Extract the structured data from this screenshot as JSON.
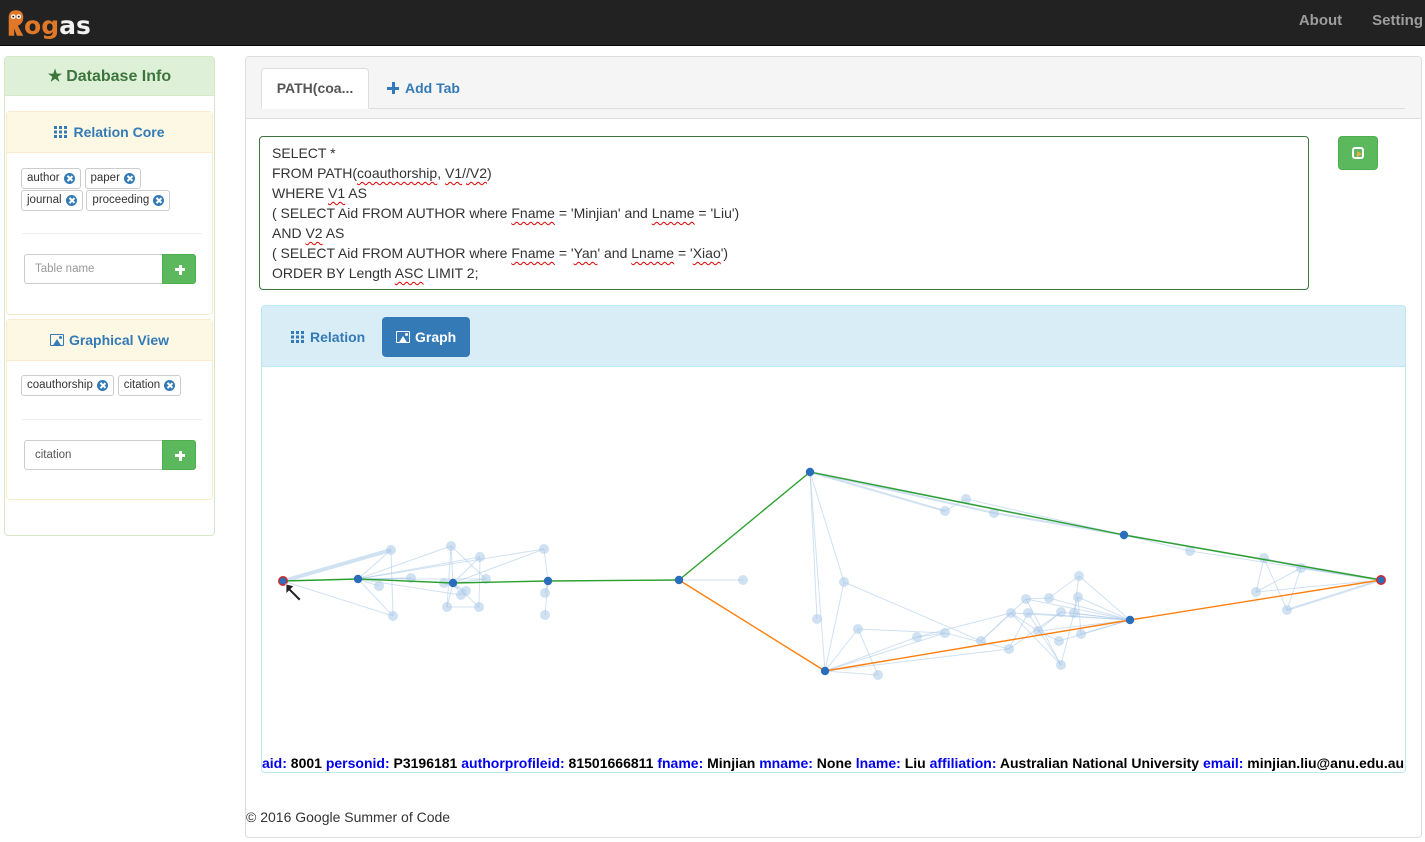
{
  "navbar": {
    "brand": {
      "first_letter": "R",
      "rest_o": "o",
      "rest_g": "g",
      "rest": "as"
    },
    "links": [
      {
        "label": "About"
      },
      {
        "label": "Setting"
      }
    ]
  },
  "sidebar": {
    "title": "Database Info",
    "title_icon": "star-icon",
    "relation_core": {
      "title": "Relation Core",
      "icon": "grid-icon",
      "tags": [
        {
          "label": "author"
        },
        {
          "label": "paper"
        },
        {
          "label": "journal"
        },
        {
          "label": "proceeding"
        }
      ],
      "input": {
        "value": "",
        "placeholder": "Table name"
      },
      "add_icon": "plus-icon"
    },
    "graphical_view": {
      "title": "Graphical View",
      "icon": "picture-icon",
      "tags": [
        {
          "label": "coauthorship"
        },
        {
          "label": "citation"
        }
      ],
      "input": {
        "value": "citation",
        "placeholder": ""
      },
      "add_icon": "plus-icon"
    }
  },
  "main": {
    "tabs": [
      {
        "label": "PATH(coa...",
        "active": true
      }
    ],
    "add_tab_label": "Add Tab",
    "query_lines": [
      [
        {
          "t": "SELECT *"
        }
      ],
      [
        {
          "t": "FROM PATH("
        },
        {
          "t": "coauthorship",
          "sq": true
        },
        {
          "t": ", "
        },
        {
          "t": "V1",
          "sq": true
        },
        {
          "t": "/"
        },
        {
          "t": "/V2",
          "sq": true
        },
        {
          "t": ")"
        }
      ],
      [
        {
          "t": "WHERE "
        },
        {
          "t": "V1",
          "sq": true
        },
        {
          "t": " AS"
        }
      ],
      [
        {
          "t": "( SELECT Aid FROM AUTHOR where "
        },
        {
          "t": "Fname",
          "sq": true
        },
        {
          "t": " = 'Minjian' and "
        },
        {
          "t": "Lname",
          "sq": true
        },
        {
          "t": " = 'Liu')"
        }
      ],
      [
        {
          "t": "AND "
        },
        {
          "t": "V2",
          "sq": true
        },
        {
          "t": " AS"
        }
      ],
      [
        {
          "t": "( SELECT Aid FROM AUTHOR where "
        },
        {
          "t": "Fname",
          "sq": true
        },
        {
          "t": " = '"
        },
        {
          "t": "Yan",
          "sq": true
        },
        {
          "t": "' and "
        },
        {
          "t": "Lname",
          "sq": true
        },
        {
          "t": " = '"
        },
        {
          "t": "Xiao",
          "sq": true
        },
        {
          "t": "')"
        }
      ],
      [
        {
          "t": "ORDER BY Length "
        },
        {
          "t": "ASC",
          "sq": true
        },
        {
          "t": " LIMIT 2;"
        }
      ]
    ],
    "run_icon": "run-query-icon",
    "result": {
      "views": [
        {
          "label": "Relation",
          "icon": "grid-icon",
          "active": false
        },
        {
          "label": "Graph",
          "icon": "picture-icon",
          "active": true
        }
      ],
      "graph": {
        "colors": {
          "node": "#2a6ebb",
          "faded": "#a9c8e8",
          "path1": "#2ca02c",
          "path2": "#ff7f0e",
          "endpoint_ring": "#d62728"
        },
        "paths": [
          {
            "name": "path-1",
            "color_key": "path1",
            "nodes": [
              "src",
              "a1",
              "a2",
              "a3",
              "hub",
              "top",
              "mid_top",
              "dst"
            ]
          },
          {
            "name": "path-2",
            "color_key": "path2",
            "nodes": [
              "hub",
              "bot",
              "mid_bot",
              "dst"
            ]
          }
        ],
        "selected_node": "src"
      },
      "info": [
        {
          "key": "aid:",
          "value": "8001"
        },
        {
          "key": "personid:",
          "value": "P3196181"
        },
        {
          "key": "authorprofileid:",
          "value": "81501666811"
        },
        {
          "key": "fname:",
          "value": "Minjian"
        },
        {
          "key": "mname:",
          "value": "None"
        },
        {
          "key": "lname:",
          "value": "Liu"
        },
        {
          "key": "affiliation:",
          "value": "Australian National University"
        },
        {
          "key": "email:",
          "value": "minjian.liu@anu.edu.au"
        }
      ]
    }
  },
  "footer": {
    "text": "© 2016 Google Summer of Code"
  }
}
